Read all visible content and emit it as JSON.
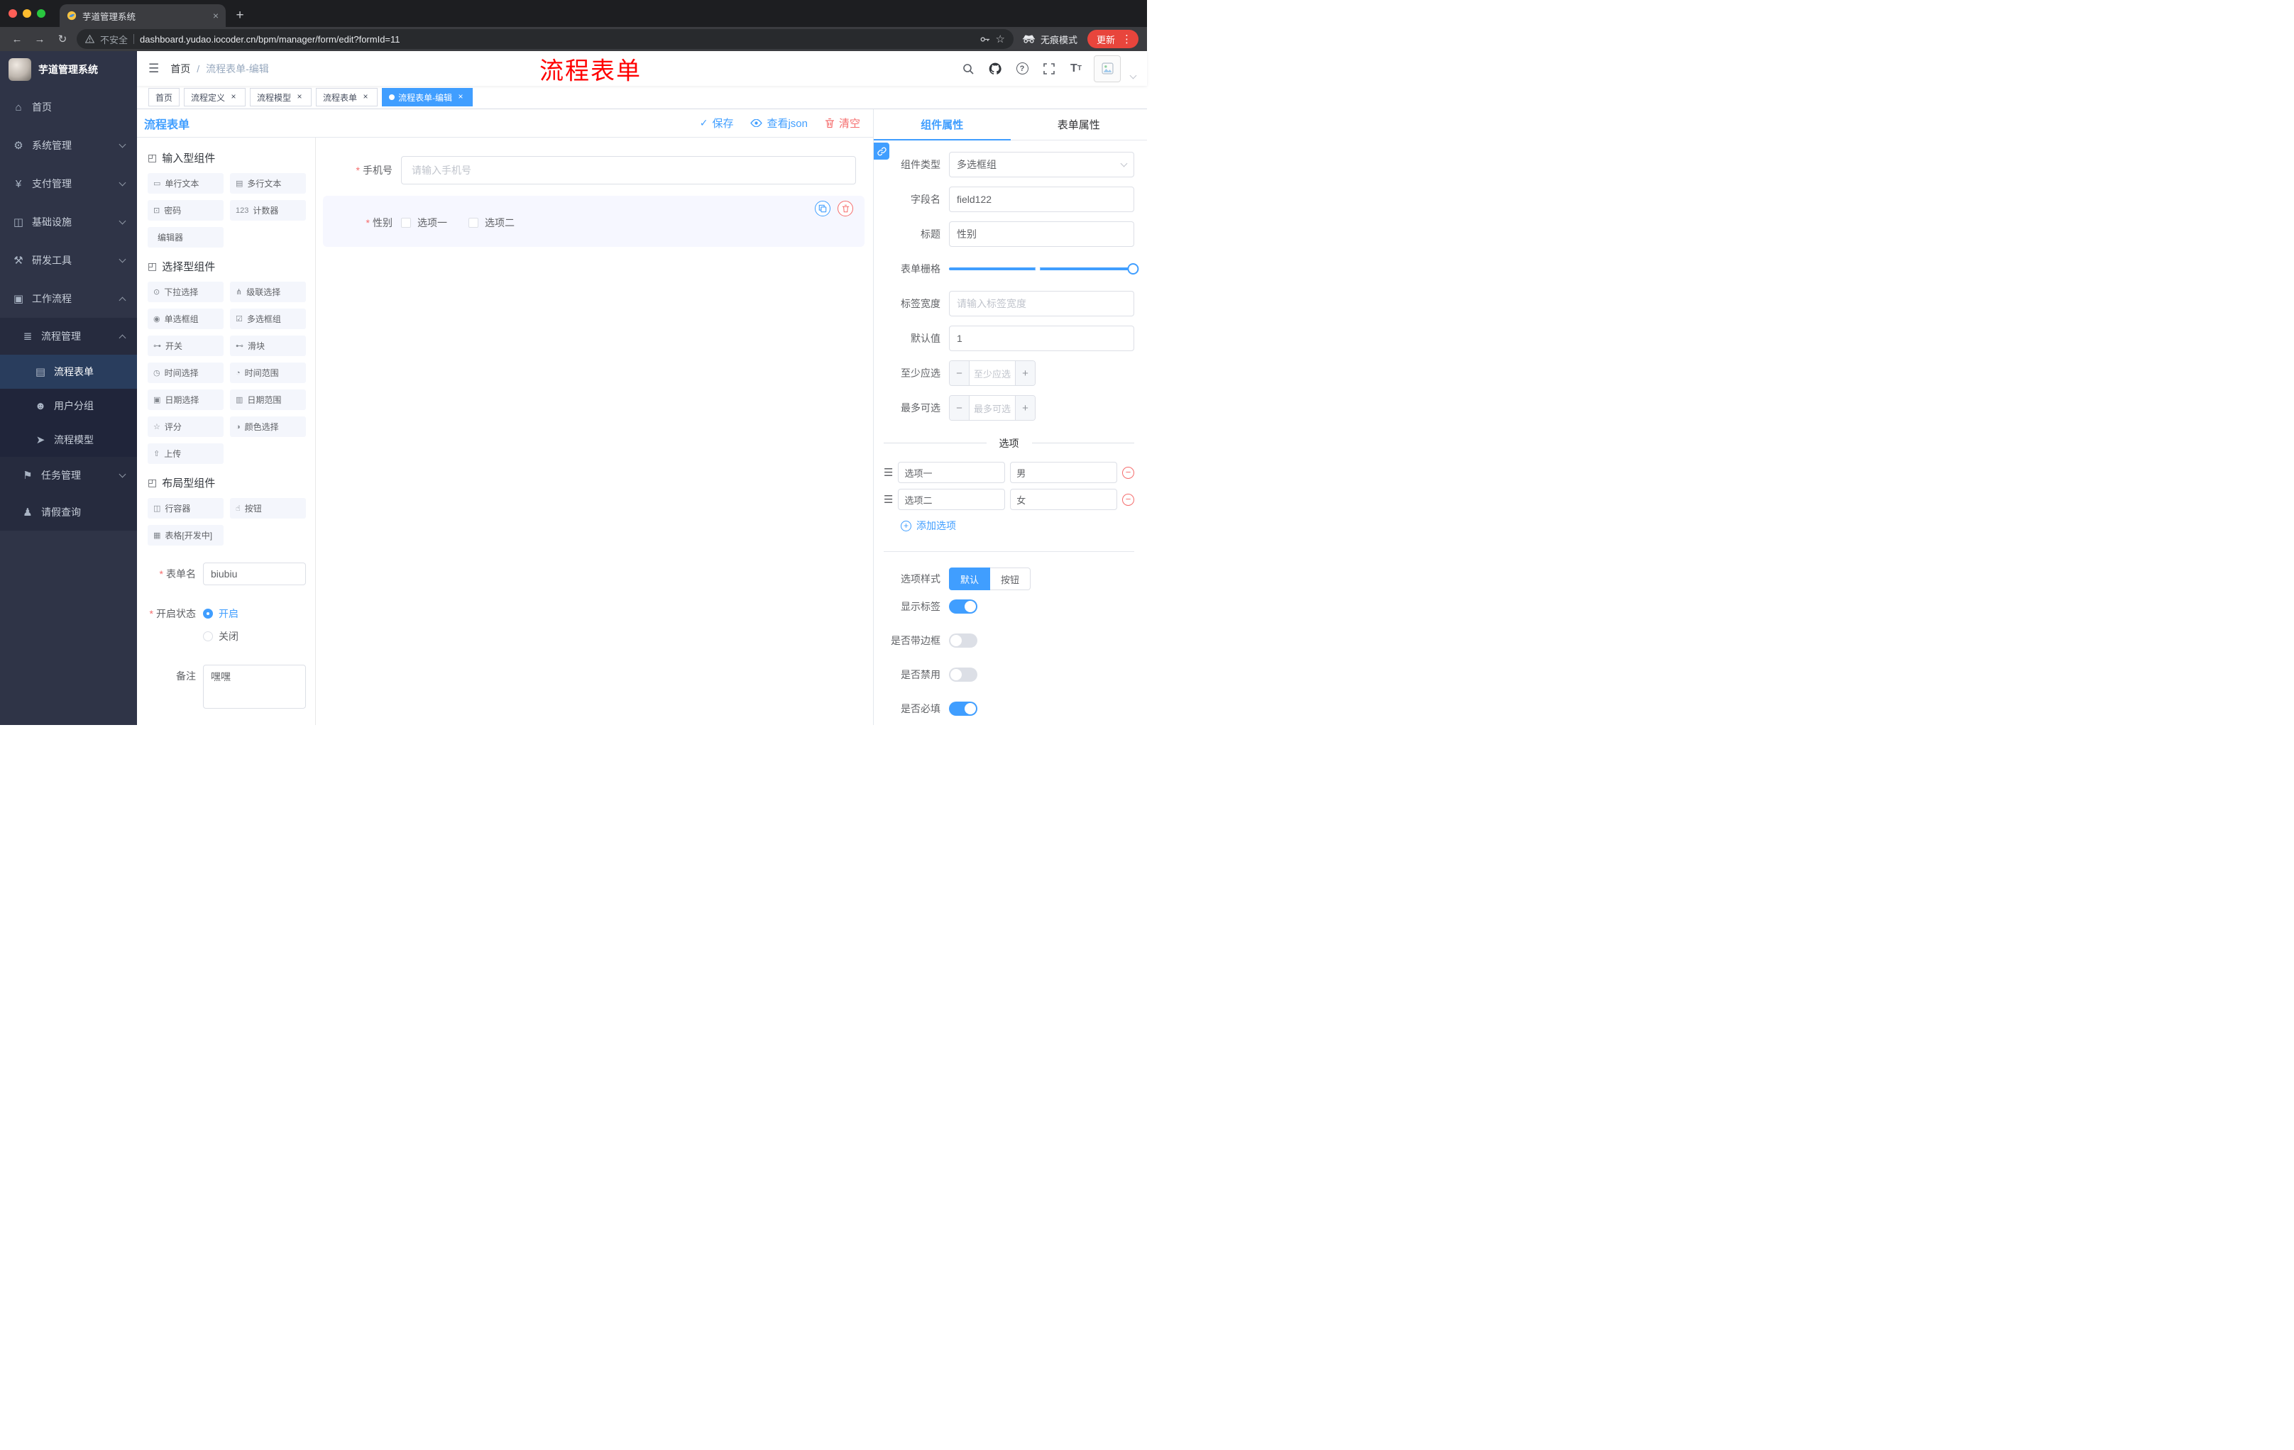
{
  "browser": {
    "tab_title": "芋道管理系统",
    "insecure_label": "不安全",
    "url": "dashboard.yudao.iocoder.cn/bpm/manager/form/edit?formId=11",
    "incognito_label": "无痕模式",
    "update_label": "更新"
  },
  "sidebar": {
    "logo_title": "芋道管理系统",
    "items": [
      {
        "label": "首页",
        "icon": "⌂"
      },
      {
        "label": "系统管理",
        "icon": "⚙"
      },
      {
        "label": "支付管理",
        "icon": "¥"
      },
      {
        "label": "基础设施",
        "icon": "◫"
      },
      {
        "label": "研发工具",
        "icon": "⚒"
      },
      {
        "label": "工作流程",
        "icon": "▣"
      }
    ],
    "process_mgmt": {
      "label": "流程管理",
      "icon": "≣"
    },
    "process_children": [
      {
        "label": "流程表单",
        "icon": "▤"
      },
      {
        "label": "用户分组",
        "icon": "☻"
      },
      {
        "label": "流程模型",
        "icon": "➤"
      }
    ],
    "task_mgmt": {
      "label": "任务管理",
      "icon": "⚑"
    },
    "leave_query": {
      "label": "请假查询",
      "icon": "♟"
    }
  },
  "header": {
    "breadcrumb_home": "首页",
    "breadcrumb_current": "流程表单-编辑",
    "annotation": "流程表单"
  },
  "tags": [
    {
      "label": "首页"
    },
    {
      "label": "流程定义"
    },
    {
      "label": "流程模型"
    },
    {
      "label": "流程表单"
    },
    {
      "label": "流程表单-编辑"
    }
  ],
  "designer": {
    "title": "流程表单",
    "save_label": "保存",
    "view_json_label": "查看json",
    "clear_label": "清空",
    "groups": [
      {
        "title": "输入型组件",
        "items": [
          {
            "label": "单行文本",
            "icon": "▭"
          },
          {
            "label": "多行文本",
            "icon": "▤"
          },
          {
            "label": "密码",
            "icon": "⊡"
          },
          {
            "label": "计数器",
            "icon": "123"
          },
          {
            "label": "编辑器",
            "icon": ""
          }
        ]
      },
      {
        "title": "选择型组件",
        "items": [
          {
            "label": "下拉选择",
            "icon": "⊙"
          },
          {
            "label": "级联选择",
            "icon": "⋔"
          },
          {
            "label": "单选框组",
            "icon": "◉"
          },
          {
            "label": "多选框组",
            "icon": "☑"
          },
          {
            "label": "开关",
            "icon": "⊶"
          },
          {
            "label": "滑块",
            "icon": "⊷"
          },
          {
            "label": "时间选择",
            "icon": "◷"
          },
          {
            "label": "时间范围",
            "icon": "◔"
          },
          {
            "label": "日期选择",
            "icon": "▣"
          },
          {
            "label": "日期范围",
            "icon": "▥"
          },
          {
            "label": "评分",
            "icon": "☆"
          },
          {
            "label": "颜色选择",
            "icon": "◑"
          },
          {
            "label": "上传",
            "icon": "⇧"
          }
        ]
      },
      {
        "title": "布局型组件",
        "items": [
          {
            "label": "行容器",
            "icon": "◫"
          },
          {
            "label": "按钮",
            "icon": "☝"
          },
          {
            "label": "表格[开发中]",
            "icon": "▦"
          }
        ]
      }
    ],
    "form_name_label": "表单名",
    "form_name_value": "biubiu",
    "status_label": "开启状态",
    "status_on": "开启",
    "status_off": "关闭",
    "remark_label": "备注",
    "remark_value": "嘿嘿",
    "canvas": {
      "phone_label": "手机号",
      "phone_placeholder": "请输入手机号",
      "gender_label": "性别",
      "gender_option1": "选项一",
      "gender_option2": "选项二"
    }
  },
  "props": {
    "tab_component": "组件属性",
    "tab_form": "表单属性",
    "component_type_label": "组件类型",
    "component_type_value": "多选框组",
    "field_name_label": "字段名",
    "field_name_value": "field122",
    "title_label": "标题",
    "title_value": "性别",
    "grid_label": "表单栅格",
    "label_width_label": "标签宽度",
    "label_width_placeholder": "请输入标签宽度",
    "default_label": "默认值",
    "default_value": "1",
    "min_label": "至少应选",
    "min_placeholder": "至少应选",
    "max_label": "最多可选",
    "max_placeholder": "最多可选",
    "options_title": "选项",
    "options": [
      {
        "label": "选项一",
        "value": "男"
      },
      {
        "label": "选项二",
        "value": "女"
      }
    ],
    "add_option_label": "添加选项",
    "option_style_label": "选项样式",
    "style_default": "默认",
    "style_button": "按钮",
    "show_label_label": "显示标签",
    "border_label": "是否带边框",
    "disabled_label": "是否禁用",
    "required_label": "是否必填"
  },
  "colors": {
    "primary": "#409eff",
    "danger": "#f56c6c",
    "annotation": "#ff0000"
  }
}
